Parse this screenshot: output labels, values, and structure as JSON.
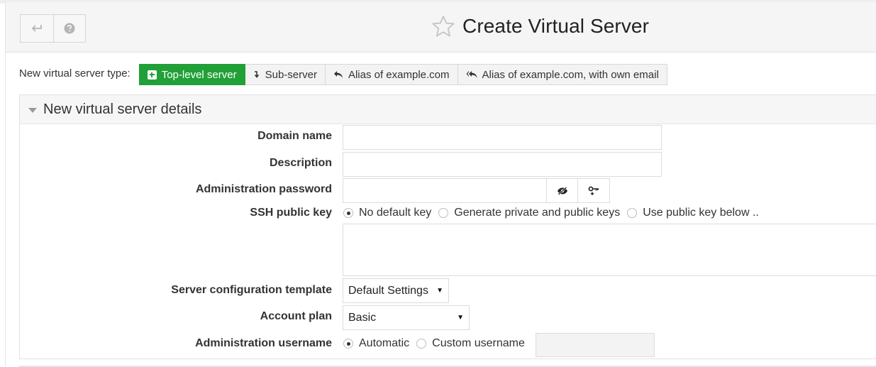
{
  "header": {
    "title": "Create Virtual Server",
    "icons": {
      "back": "return-arrow-icon",
      "help": "question-circle-icon",
      "favorite": "star-outline-icon"
    }
  },
  "server_type": {
    "label": "New virtual server type:",
    "options": [
      {
        "label": "Top-level server",
        "icon": "plus-square-icon",
        "active": true
      },
      {
        "label": "Sub-server",
        "icon": "arrow-down-turn-icon",
        "active": false
      },
      {
        "label": "Alias of example.com",
        "icon": "reply-icon",
        "active": false
      },
      {
        "label": "Alias of example.com, with own email",
        "icon": "reply-all-icon",
        "active": false
      }
    ]
  },
  "section": {
    "title": "New virtual server details"
  },
  "form": {
    "domain_name": {
      "label": "Domain name",
      "value": ""
    },
    "description": {
      "label": "Description",
      "value": ""
    },
    "admin_password": {
      "label": "Administration password",
      "value": "",
      "icons": [
        "eye-slash-icon",
        "key-plus-icon"
      ]
    },
    "ssh_key": {
      "label": "SSH public key",
      "options": [
        "No default key",
        "Generate private and public keys",
        "Use public key below .."
      ],
      "selected": "No default key",
      "value": ""
    },
    "config_template": {
      "label": "Server configuration template",
      "value": "Default Settings"
    },
    "account_plan": {
      "label": "Account plan",
      "value": "Basic"
    },
    "admin_username": {
      "label": "Administration username",
      "options": [
        "Automatic",
        "Custom username"
      ],
      "selected": "Automatic",
      "value": ""
    }
  },
  "colors": {
    "accent": "#21a038",
    "header_bg": "#f5f5f5",
    "border": "#dcdcdc"
  }
}
